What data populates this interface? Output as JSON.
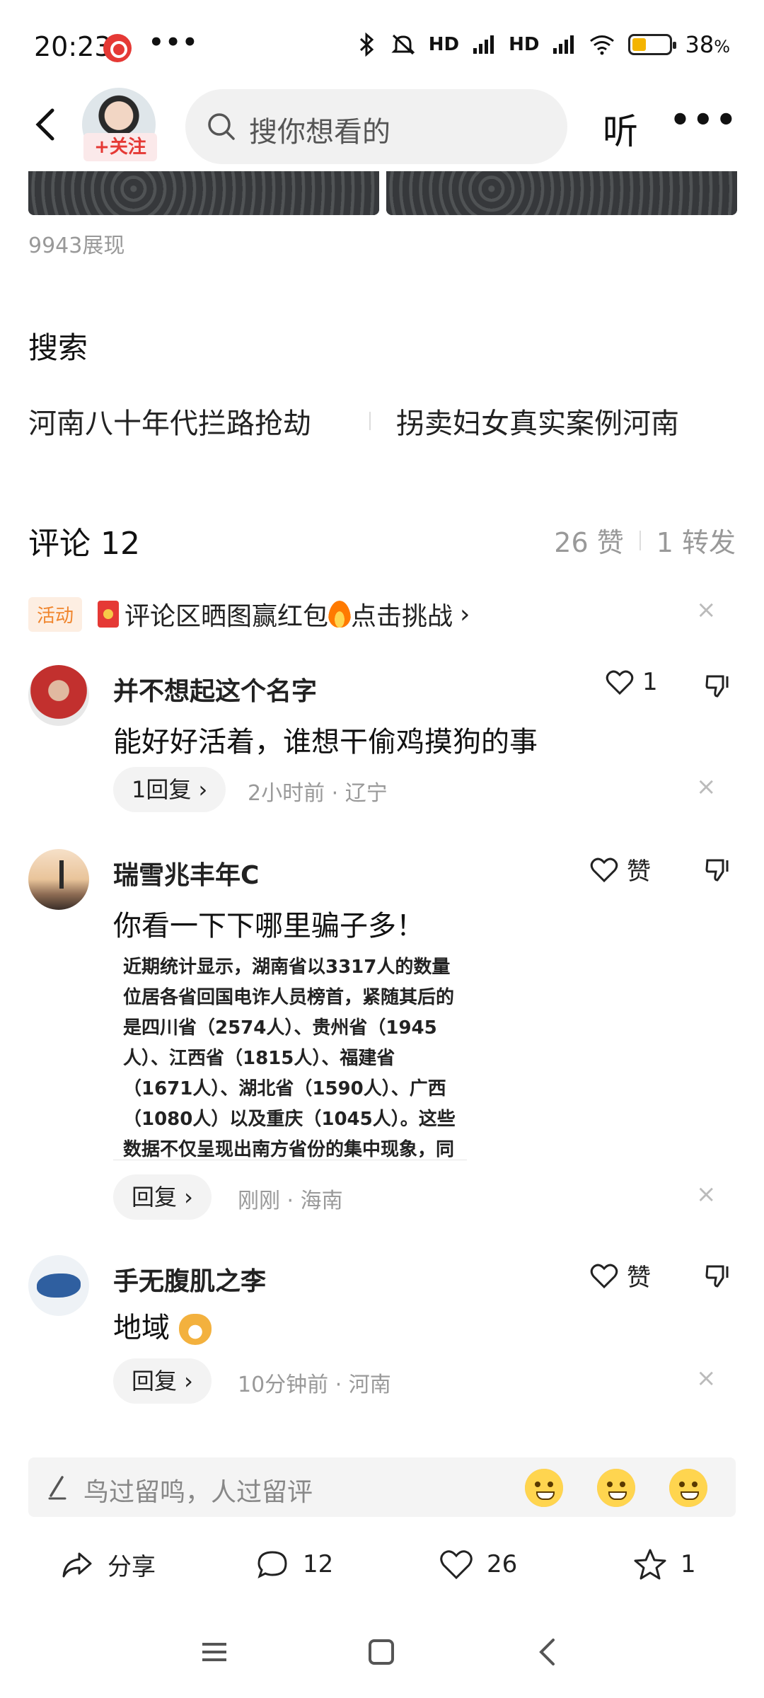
{
  "status": {
    "time": "20:23",
    "dots": "•••",
    "hd1": "HD",
    "hd2": "HD",
    "battery_percent": "38",
    "battery_unit": "%",
    "battery_level": 0.38
  },
  "header": {
    "follow_label": "+关注",
    "search_placeholder": "搜你想看的",
    "listen_label": "听",
    "more_label": "•••"
  },
  "views_text": "9943展现",
  "search_section": {
    "title": "搜索",
    "links": [
      "河南八十年代拦路抢劫",
      "拐卖妇女真实案例河南"
    ]
  },
  "comments_section": {
    "title": "评论 12",
    "likes": "26 赞",
    "shares": "1 转发",
    "activity_tag": "活动",
    "activity_text": "评论区晒图赢红包",
    "activity_cta": "点击挑战",
    "activity_arrow": "›",
    "close_icon": "×"
  },
  "comments": [
    {
      "name": "并不想起这个名字",
      "text": "能好好活着，谁想干偷鸡摸狗的事",
      "like_label": "1",
      "reply_label": "1回复 ›",
      "meta": "2小时前 · 辽宁"
    },
    {
      "name": "瑞雪兆丰年C",
      "text": "你看一下下哪里骗子多！",
      "like_label": "赞",
      "image_text": "近期统计显示，湖南省以3317人的数量位居各省回国电诈人员榜首，紧随其后的是四川省（2574人）、贵州省（1945人）、江西省（1815人）、福建省（1671人）、湖北省（1590人）、广西（1080人）以及重庆（1045人）。这些数据不仅呈现出南方省份的集中现象，同时也揭",
      "reply_label": "回复 ›",
      "meta": "刚刚 · 海南"
    },
    {
      "name": "手无腹肌之李",
      "text": "地域",
      "like_label": "赞",
      "reply_label": "回复 ›",
      "meta": "10分钟前 · 河南"
    }
  ],
  "input": {
    "placeholder": "鸟过留鸣，人过留评"
  },
  "actions": {
    "share": "分享",
    "comment_count": "12",
    "like_count": "26",
    "fav_count": "1"
  },
  "colors": {
    "accent_red": "#e53935",
    "activity_orange": "#f0852d",
    "muted_gray": "#999999"
  }
}
